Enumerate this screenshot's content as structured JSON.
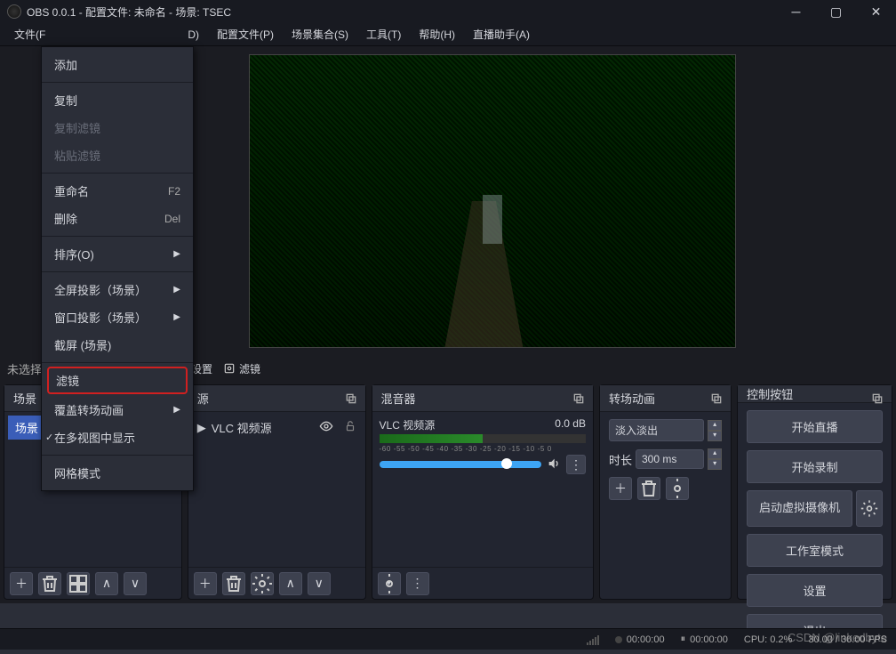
{
  "title": "OBS 0.0.1 - 配置文件: 未命名 - 场景: TSEC",
  "menu": {
    "file": "文件(F",
    "d": "D)",
    "profiles": "配置文件(P)",
    "scene_collections": "场景集合(S)",
    "tools": "工具(T)",
    "help": "帮助(H)",
    "live_assist": "直播助手(A)"
  },
  "no_select": "未选择",
  "settings_btn": "设置",
  "filters_btn": "滤镜",
  "docks": {
    "scenes": "场景",
    "sources": "源",
    "mixer": "混音器",
    "transitions": "转场动画",
    "controls": "控制按钮"
  },
  "scene_item": "场景",
  "source_item": "VLC 视频源",
  "mixer_ch": {
    "name": "VLC 视频源",
    "db": "0.0 dB",
    "ticks": "-60 -55 -50 -45 -40 -35 -30 -25 -20 -15 -10 -5 0"
  },
  "transitions_data": {
    "mode": "淡入淡出",
    "duration_label": "时长",
    "duration": "300 ms"
  },
  "controls_btns": {
    "start_stream": "开始直播",
    "start_record": "开始录制",
    "start_vcam": "启动虚拟摄像机",
    "studio": "工作室模式",
    "settings": "设置",
    "exit": "退出"
  },
  "status": {
    "rec_time": "00:00:00",
    "stream_time": "00:00:00",
    "cpu": "CPU: 0.2%",
    "fps": "30.00 / 30.00 FPS"
  },
  "context_menu": {
    "add": "添加",
    "copy": "复制",
    "copy_filters": "复制滤镜",
    "paste_filters": "粘贴滤镜",
    "rename": "重命名",
    "rename_key": "F2",
    "delete": "删除",
    "delete_key": "Del",
    "order": "排序(O)",
    "fullscreen_proj": "全屏投影（场景）",
    "window_proj": "窗口投影（场景）",
    "screenshot": "截屏 (场景)",
    "filters": "滤镜",
    "override_trans": "覆盖转场动画",
    "multiview_show": "在多视图中显示",
    "grid_mode": "网格模式"
  },
  "watermark": "CSDN @linkedbyte"
}
